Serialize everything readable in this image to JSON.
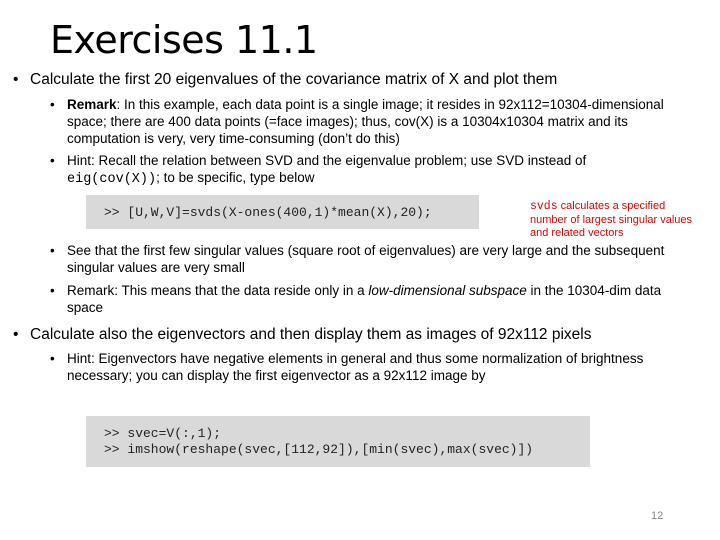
{
  "title": "Exercises 11.1",
  "bullet1": {
    "text": "Calculate the first 20 eigenvalues of the covariance matrix of X and plot them",
    "remark1": {
      "bold": "Remark",
      "text": ": In this example, each data point is a single image; it resides in 92x112=10304-dimensional space; there are 400 data points (=face images); thus, cov(X) is a 10304x10304 matrix and its computation is very, very time-consuming (don’t do this)"
    },
    "hint1": {
      "text_before": "Hint: Recall the relation between SVD and the eigenvalue problem; use SVD instead of ",
      "code": "eig(cov(X))",
      "text_after": "; to be specific, type below"
    },
    "code1": ">> [U,W,V]=svds(X-ones(400,1)*mean(X),20);",
    "side_note": {
      "code": "svds",
      "text": " calculates a specified number of largest singular values and related vectors"
    },
    "point3": "See that the first few singular values (square root of eigenvalues) are very large and the subsequent singular values are very small",
    "remark2": {
      "text_before": "Remark: This means that the data reside only in a ",
      "italic": "low-dimensional subspace",
      "text_after": " in the 10304-dim data space"
    }
  },
  "bullet2": {
    "text": "Calculate also the eigenvectors and then display them as images of 92x112 pixels",
    "hint": "Hint: Eigenvectors have negative elements in general and thus some normalization of brightness necessary; you can display the first eigenvector as a 92x112 image by",
    "code_lines": [
      ">> svec=V(:,1);",
      ">> imshow(reshape(svec,[112,92]),[min(svec),max(svec)])"
    ]
  },
  "page_number": "12"
}
